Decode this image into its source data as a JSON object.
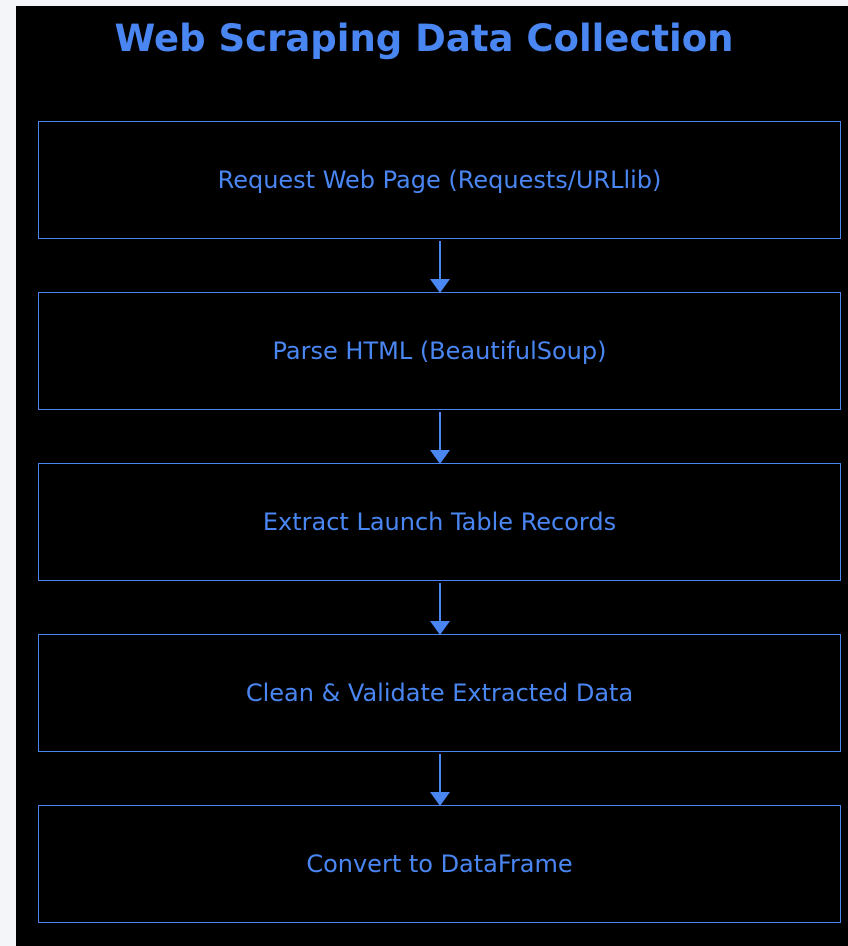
{
  "diagram": {
    "title": "Web Scraping Data Collection",
    "accent_color": "#4a86f2",
    "background_color": "#000000",
    "steps": [
      {
        "label": "Request Web Page (Requests/URLlib)"
      },
      {
        "label": "Parse HTML (BeautifulSoup)"
      },
      {
        "label": "Extract Launch Table Records"
      },
      {
        "label": "Clean & Validate Extracted Data"
      },
      {
        "label": "Convert to DataFrame"
      }
    ],
    "connectors": [
      {
        "from": 0,
        "to": 1
      },
      {
        "from": 1,
        "to": 2
      },
      {
        "from": 2,
        "to": 3
      },
      {
        "from": 3,
        "to": 4
      }
    ]
  }
}
